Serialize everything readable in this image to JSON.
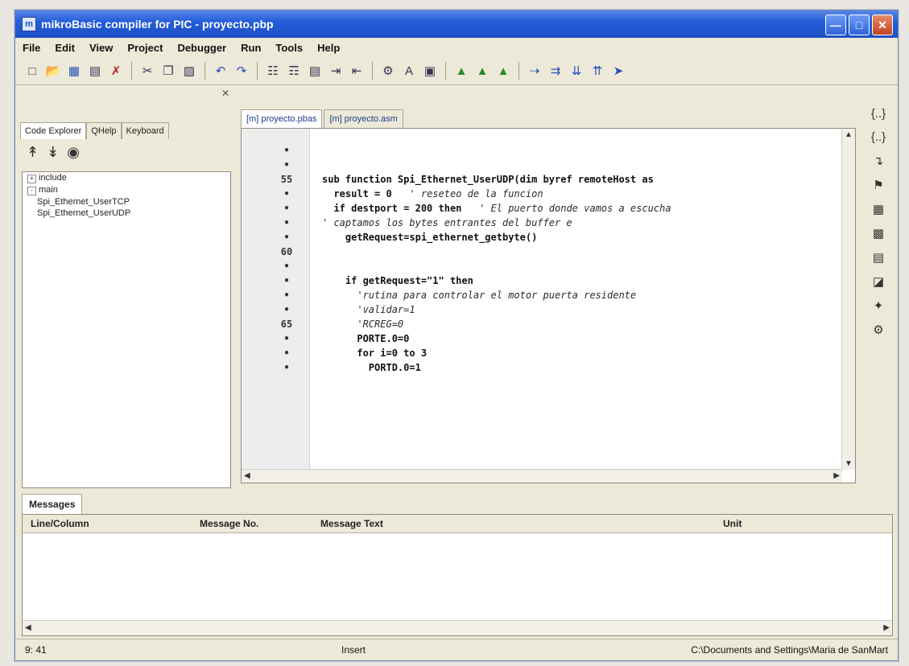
{
  "window": {
    "title": "mikroBasic compiler for PIC - proyecto.pbp"
  },
  "menu": [
    "File",
    "Edit",
    "View",
    "Project",
    "Debugger",
    "Run",
    "Tools",
    "Help"
  ],
  "left_panel": {
    "tabs": [
      "Code Explorer",
      "QHelp",
      "Keyboard"
    ],
    "tree": [
      {
        "label": "include",
        "level": 0
      },
      {
        "label": "main",
        "level": 0
      },
      {
        "label": "Spi_Ethernet_UserTCP",
        "level": 1
      },
      {
        "label": "Spi_Ethernet_UserUDP",
        "level": 1
      }
    ]
  },
  "editor": {
    "tabs": [
      "[m] proyecto.pbas",
      "[m] proyecto.asm"
    ],
    "lines": [
      {
        "ln": "•",
        "code": ""
      },
      {
        "ln": "•",
        "code": ""
      },
      {
        "ln": "55",
        "code": "sub function Spi_Ethernet_UserUDP(dim byref remoteHost as"
      },
      {
        "ln": "•",
        "code": "  result = 0",
        "comment": "' reseteo de la funcion"
      },
      {
        "ln": "•",
        "code": "  if destport = 200 then",
        "comment": "' El puerto donde vamos a escucha"
      },
      {
        "ln": "•",
        "code": "",
        "comment": "' captamos los bytes entrantes del buffer e"
      },
      {
        "ln": "•",
        "code": "    getRequest=spi_ethernet_getbyte()"
      },
      {
        "ln": "60",
        "code": ""
      },
      {
        "ln": "•",
        "code": ""
      },
      {
        "ln": "•",
        "code": "    if getRequest=\"1\" then"
      },
      {
        "ln": "•",
        "code": "",
        "comment": "      'rutina para controlar el motor puerta residente"
      },
      {
        "ln": "•",
        "code": "",
        "comment": "      'validar=1"
      },
      {
        "ln": "65",
        "code": "",
        "comment": "      'RCREG=0"
      },
      {
        "ln": "•",
        "code": "      PORTE.0=0"
      },
      {
        "ln": "•",
        "code": "      for i=0 to 3"
      },
      {
        "ln": "•",
        "code": "        PORTD.0=1"
      }
    ]
  },
  "messages": {
    "tab": "Messages",
    "columns": [
      "Line/Column",
      "Message No.",
      "Message Text",
      "Unit"
    ]
  },
  "status": {
    "position": "9: 41",
    "mode": "Insert",
    "path": "C:\\Documents and Settings\\Maria de SanMart"
  }
}
